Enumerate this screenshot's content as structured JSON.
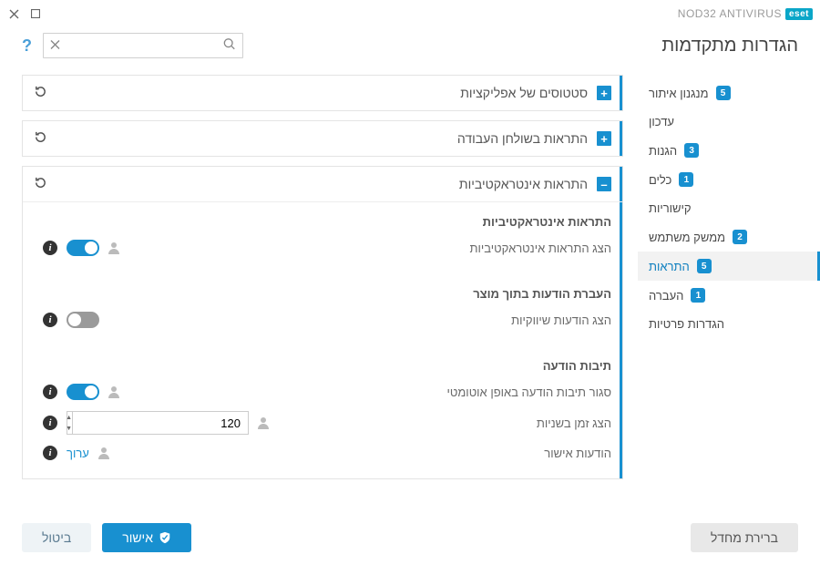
{
  "titlebar": {
    "brand_badge": "eset",
    "product": "NOD32 ANTIVIRUS"
  },
  "page_title": "הגדרות מתקדמות",
  "search": {
    "placeholder": ""
  },
  "sidebar": {
    "items": [
      {
        "label": "מנגנון איתור",
        "badge": "5"
      },
      {
        "label": "עדכון",
        "badge": null
      },
      {
        "label": "הגנות",
        "badge": "3"
      },
      {
        "label": "כלים",
        "badge": "1"
      },
      {
        "label": "קישוריות",
        "badge": null
      },
      {
        "label": "ממשק משתמש",
        "badge": "2"
      },
      {
        "label": "התראות",
        "badge": "5"
      },
      {
        "label": "העברה",
        "badge": "1"
      },
      {
        "label": "הגדרות פרטיות",
        "badge": null
      }
    ]
  },
  "panels": {
    "app_status": {
      "title": "סטטוסים של אפליקציות"
    },
    "desktop": {
      "title": "התראות בשולחן העבודה"
    },
    "interactive": {
      "title": "התראות אינטראקטיביות",
      "section1_heading": "התראות אינטראקטיביות",
      "row_show_interactive": "הצג התראות אינטראקטיביות",
      "section2_heading": "העברת הודעות בתוך מוצר",
      "row_marketing": "הצג הודעות שיווקיות",
      "section3_heading": "תיבות הודעה",
      "row_autoclose": "סגור תיבות הודעה באופן אוטומטי",
      "row_seconds": "הצג זמן בשניות",
      "seconds_value": "120",
      "row_confirm": "הודעות אישור",
      "edit_link": "ערוך"
    }
  },
  "footer": {
    "default": "ברירת מחדל",
    "ok": "אישור",
    "cancel": "ביטול"
  }
}
